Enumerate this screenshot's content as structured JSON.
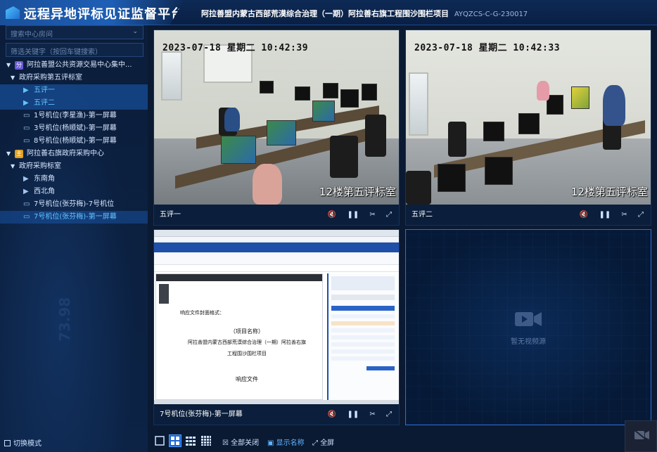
{
  "app": {
    "title": "远程异地评标见证监督平台"
  },
  "project": {
    "title": "阿拉善盟内蒙古西部荒漠综合治理（一期）阿拉善右旗工程围沙围栏项目",
    "code": "AYQZCS-C-G-230017"
  },
  "sidebar": {
    "search_placeholder": "搜索中心房间",
    "filter_placeholder": "筛选关键字（按回车键搜索）",
    "tree": [
      {
        "level": 0,
        "type": "center",
        "badge": "分",
        "badge_color": "#6a5bd6",
        "label": "阿拉善盟公共资源交易中心集中...",
        "expanded": true
      },
      {
        "level": 1,
        "type": "room",
        "label": "政府采购第五评标室",
        "expanded": true
      },
      {
        "level": 2,
        "type": "camera",
        "label": "五评一",
        "selected": true
      },
      {
        "level": 2,
        "type": "camera",
        "label": "五评二",
        "selected": true
      },
      {
        "level": 2,
        "type": "monitor",
        "label": "1号机位(李星渔)-第一屏幕"
      },
      {
        "level": 2,
        "type": "monitor",
        "label": "3号机位(杨顺斌)-第一屏幕"
      },
      {
        "level": 2,
        "type": "monitor",
        "label": "8号机位(杨顺斌)-第一屏幕"
      },
      {
        "level": 0,
        "type": "center",
        "badge": "主",
        "badge_color": "#e0a020",
        "label": "阿拉善右旗政府采购中心",
        "expanded": true
      },
      {
        "level": 1,
        "type": "room",
        "label": "政府采购标室",
        "expanded": true
      },
      {
        "level": 2,
        "type": "camera",
        "label": "东南角"
      },
      {
        "level": 2,
        "type": "camera",
        "label": "西北角"
      },
      {
        "level": 2,
        "type": "monitor",
        "label": "7号机位(张芬梅)-7号机位"
      },
      {
        "level": 2,
        "type": "monitor",
        "label": "7号机位(张芬梅)-第一屏幕",
        "selected": true
      }
    ],
    "switch_mode_label": "切换模式"
  },
  "tiles": [
    {
      "name": "五评一",
      "timestamp": "2023-07-18 星期二 10:42:39",
      "room_label": "12楼第五评标室"
    },
    {
      "name": "五评二",
      "timestamp": "2023-07-18 星期二 10:42:33",
      "room_label": "12楼第五评标室"
    },
    {
      "name": "7号机位(张芬梅)-第一屏幕",
      "doc": {
        "heading": "响应文件封面格式：",
        "project_placeholder": "（项目名称）",
        "project_line1": "阿拉善盟内蒙古西部荒漠综合治理（一期）阿拉善右旗",
        "project_line2": "工程围沙围栏项目",
        "doc_type": "响应文件"
      }
    },
    {
      "name": "",
      "empty_text": "暂无视频源"
    }
  ],
  "toolbar": {
    "close_all_label": "全部关闭",
    "show_name_label": "显示名称",
    "fullscreen_label": "全屏",
    "active_layout": "2x2"
  },
  "colors": {
    "accent": "#1e66d0",
    "highlight": "#5fb4ff",
    "background": "#0a1a33"
  }
}
